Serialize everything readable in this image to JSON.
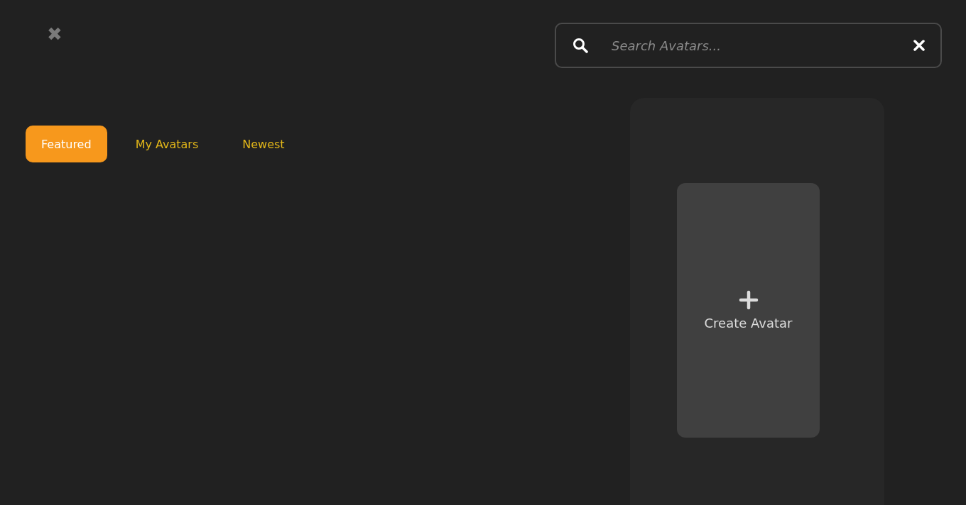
{
  "close_button": {
    "label": "✖"
  },
  "tabs": [
    {
      "label": "Featured",
      "selected": true
    },
    {
      "label": "My Avatars",
      "selected": false
    },
    {
      "label": "Newest",
      "selected": false
    }
  ],
  "search": {
    "placeholder": "Search Avatars..."
  },
  "create_card": {
    "label": "Create Avatar"
  }
}
